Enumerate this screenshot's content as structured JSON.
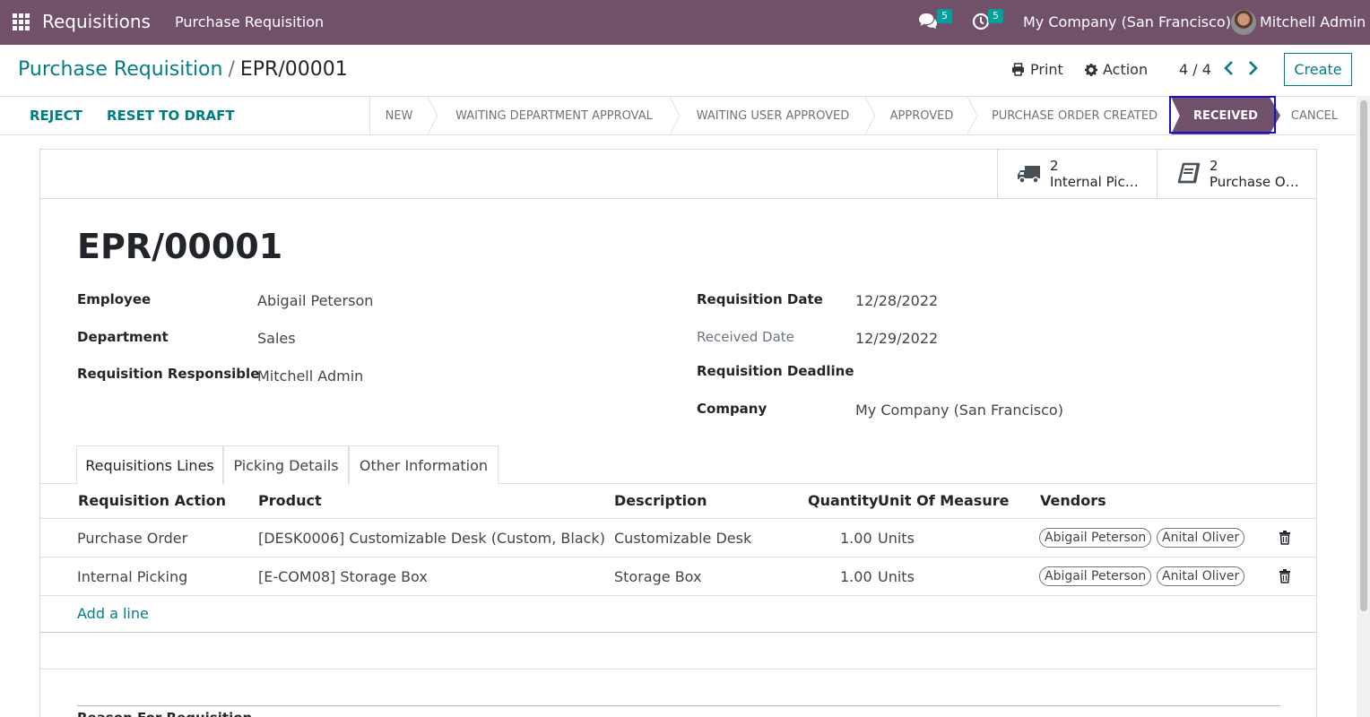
{
  "navbar": {
    "app_name": "Requisitions",
    "menu_item": "Purchase Requisition",
    "messages_badge": "5",
    "activities_badge": "5",
    "company": "My Company (San Francisco)",
    "user": "Mitchell Admin"
  },
  "breadcrumb": {
    "parent": "Purchase Requisition",
    "separator": "/",
    "current": "EPR/00001"
  },
  "control": {
    "print_label": "Print",
    "action_label": "Action",
    "pager": "4 / 4",
    "create_label": "Create"
  },
  "statusbar": {
    "reject_label": "REJECT",
    "reset_label": "RESET TO DRAFT",
    "stages": [
      "NEW",
      "WAITING DEPARTMENT APPROVAL",
      "WAITING USER APPROVED",
      "APPROVED",
      "PURCHASE ORDER CREATED",
      "RECEIVED",
      "CANCEL"
    ],
    "active_stage": "RECEIVED"
  },
  "smart_buttons": [
    {
      "count": "2",
      "label": "Internal Pic…",
      "icon": "truck-icon"
    },
    {
      "count": "2",
      "label": "Purchase O…",
      "icon": "book-icon"
    }
  ],
  "record": {
    "title": "EPR/00001",
    "employee_label": "Employee",
    "employee": "Abigail Peterson",
    "department_label": "Department",
    "department": "Sales",
    "responsible_label": "Requisition Responsible",
    "responsible": "Mitchell Admin",
    "req_date_label": "Requisition Date",
    "req_date": "12/28/2022",
    "received_date_label": "Received Date",
    "received_date": "12/29/2022",
    "deadline_label": "Requisition Deadline",
    "company_label": "Company",
    "company": "My Company (San Francisco)"
  },
  "tabs": [
    "Requisitions Lines",
    "Picking Details",
    "Other Information"
  ],
  "table": {
    "columns": [
      "Requisition Action",
      "Product",
      "Description",
      "Quantity",
      "Unit Of Measure",
      "Vendors"
    ],
    "rows": [
      {
        "action": "Purchase Order",
        "product": "[DESK0006] Customizable Desk (Custom, Black)",
        "description": "Customizable Desk",
        "quantity": "1.00",
        "uom": "Units",
        "vendors": [
          "Abigail Peterson",
          "Anital Oliver"
        ]
      },
      {
        "action": "Internal Picking",
        "product": "[E-COM08] Storage Box",
        "description": "Storage Box",
        "quantity": "1.00",
        "uom": "Units",
        "vendors": [
          "Abigail Peterson",
          "Anital Oliver"
        ]
      }
    ],
    "add_line": "Add a line"
  },
  "reason_label": "Reason For Requisition",
  "colors": {
    "brand": "#71506a",
    "link": "#017e84",
    "badge": "#00a09d"
  }
}
